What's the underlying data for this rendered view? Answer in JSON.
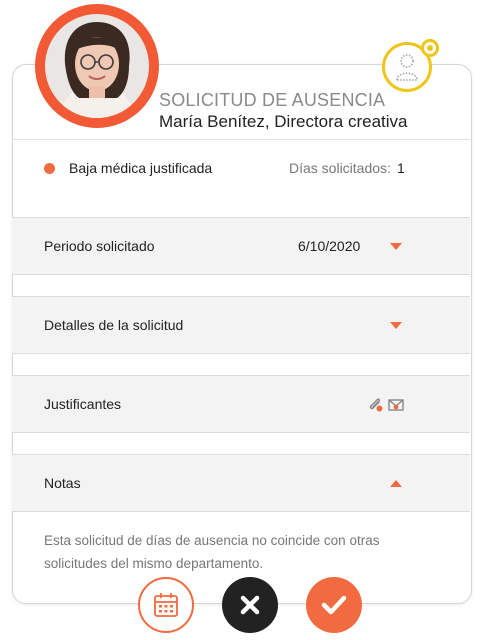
{
  "header": {
    "title": "SOLICITUD DE AUSENCIA",
    "employee": "María Benítez, Directora creativa"
  },
  "request": {
    "type_label": "Baja médica justificada",
    "days_label": "Días solicitados:",
    "days_value": "1"
  },
  "sections": [
    {
      "label": "Periodo solicitado",
      "value": "6/10/2020"
    },
    {
      "label": "Detalles de la solicitud"
    },
    {
      "label": "Justificantes"
    },
    {
      "label": "Notas"
    }
  ],
  "notes": {
    "text": "Esta solicitud de días de ausencia no coincide con otras solicitudes del  mismo departamento."
  },
  "icons": {
    "avatar": "person-photo",
    "badge": "user-icon",
    "attachment": "paperclip-icon",
    "message": "envelope-icon",
    "calendar": "calendar-icon",
    "reject": "close-icon",
    "approve": "check-icon"
  },
  "colors": {
    "accent": "#f26a3f",
    "badge": "#f0c419",
    "reject": "#222222",
    "section_bg": "#f3f3f3"
  }
}
